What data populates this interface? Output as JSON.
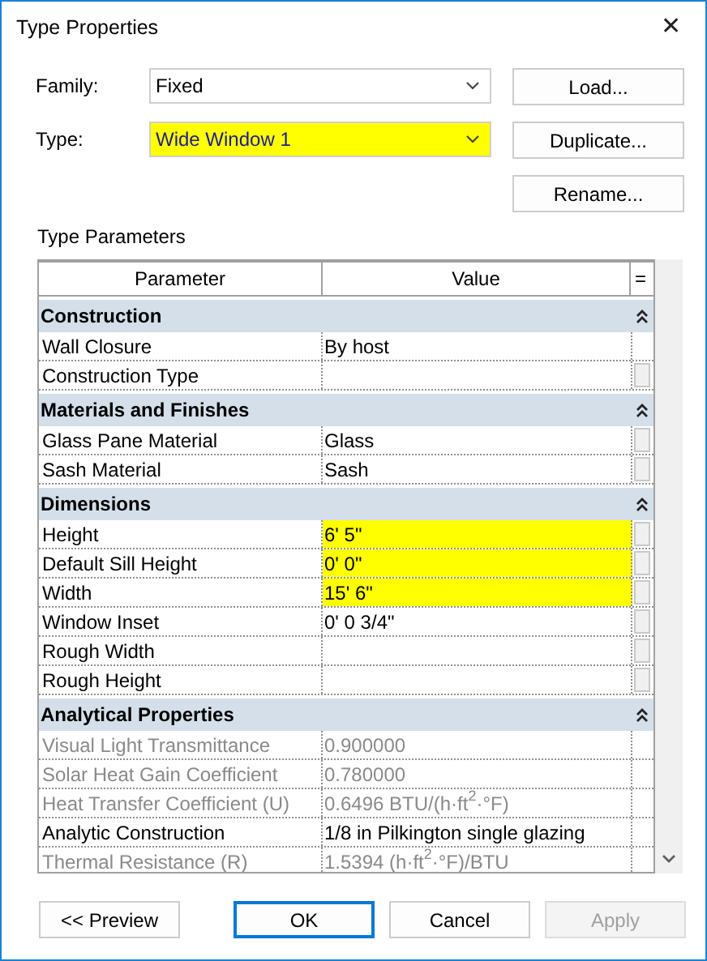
{
  "window": {
    "title": "Type Properties",
    "close": "✕"
  },
  "fields": [
    {
      "label": "Family:",
      "value": "Fixed",
      "highlighted": false
    },
    {
      "label": "Type:",
      "value": "Wide Window 1",
      "highlighted": true
    }
  ],
  "side_buttons": [
    "Load...",
    "Duplicate...",
    "Rename..."
  ],
  "section_title": "Type Parameters",
  "table": {
    "columns": [
      "Parameter",
      "Value",
      "="
    ],
    "rows": [
      {
        "kind": "group",
        "name": "Construction",
        "expanded": true
      },
      {
        "kind": "param",
        "name": "Wall Closure",
        "value": "By host",
        "highlighted": false,
        "disabled": false,
        "edit_button": false
      },
      {
        "kind": "param",
        "name": "Construction Type",
        "highlighted": false,
        "disabled": false,
        "edit_button": true
      },
      {
        "kind": "group",
        "name": "Materials and Finishes",
        "expanded": true
      },
      {
        "kind": "param",
        "name": "Glass Pane Material",
        "value": "Glass",
        "highlighted": false,
        "disabled": false,
        "edit_button": true
      },
      {
        "kind": "param",
        "name": "Sash Material",
        "value": "Sash",
        "highlighted": false,
        "disabled": false,
        "edit_button": true
      },
      {
        "kind": "group",
        "name": "Dimensions",
        "expanded": true
      },
      {
        "kind": "param",
        "name": "Height",
        "value": "6'  5\"",
        "highlighted": true,
        "disabled": false,
        "edit_button": true
      },
      {
        "kind": "param",
        "name": "Default Sill Height",
        "value": "0'  0\"",
        "highlighted": true,
        "disabled": false,
        "edit_button": true
      },
      {
        "kind": "param",
        "name": "Width",
        "value": "15'  6\"",
        "highlighted": true,
        "disabled": false,
        "edit_button": true
      },
      {
        "kind": "param",
        "name": "Window Inset",
        "value": "0'  0 3/4\"",
        "highlighted": false,
        "disabled": false,
        "edit_button": true
      },
      {
        "kind": "param",
        "name": "Rough Width",
        "highlighted": false,
        "disabled": false,
        "edit_button": true
      },
      {
        "kind": "param",
        "name": "Rough Height",
        "highlighted": false,
        "disabled": false,
        "edit_button": true
      },
      {
        "kind": "group",
        "name": "Analytical Properties",
        "expanded": true
      },
      {
        "kind": "param",
        "name": "Visual Light Transmittance",
        "value": "0.900000",
        "highlighted": false,
        "disabled": true,
        "edit_button": false
      },
      {
        "kind": "param",
        "name": "Solar Heat Gain Coefficient",
        "value": "0.780000",
        "highlighted": false,
        "disabled": true,
        "edit_button": false
      },
      {
        "kind": "param",
        "name": "Heat Transfer Coefficient (U)",
        "value": "0.6496 BTU/(h·ft$^{2}$·°F)",
        "highlighted": false,
        "disabled": true,
        "edit_button": false
      },
      {
        "kind": "param",
        "name": "Analytic Construction",
        "value": "1/8 in Pilkington single glazing",
        "highlighted": false,
        "disabled": false,
        "edit_button": false
      },
      {
        "kind": "param",
        "name": "Thermal Resistance (R)",
        "value": "1.5394 (h·ft$^{2}$·°F)/BTU",
        "highlighted": false,
        "disabled": true,
        "edit_button": false
      }
    ]
  },
  "buttons": [
    {
      "label": "<< Preview",
      "default": false,
      "disabled": false
    },
    {
      "label": "OK",
      "default": true,
      "disabled": false
    },
    {
      "label": "Cancel",
      "default": false,
      "disabled": false
    },
    {
      "label": "Apply",
      "default": false,
      "disabled": true
    }
  ]
}
